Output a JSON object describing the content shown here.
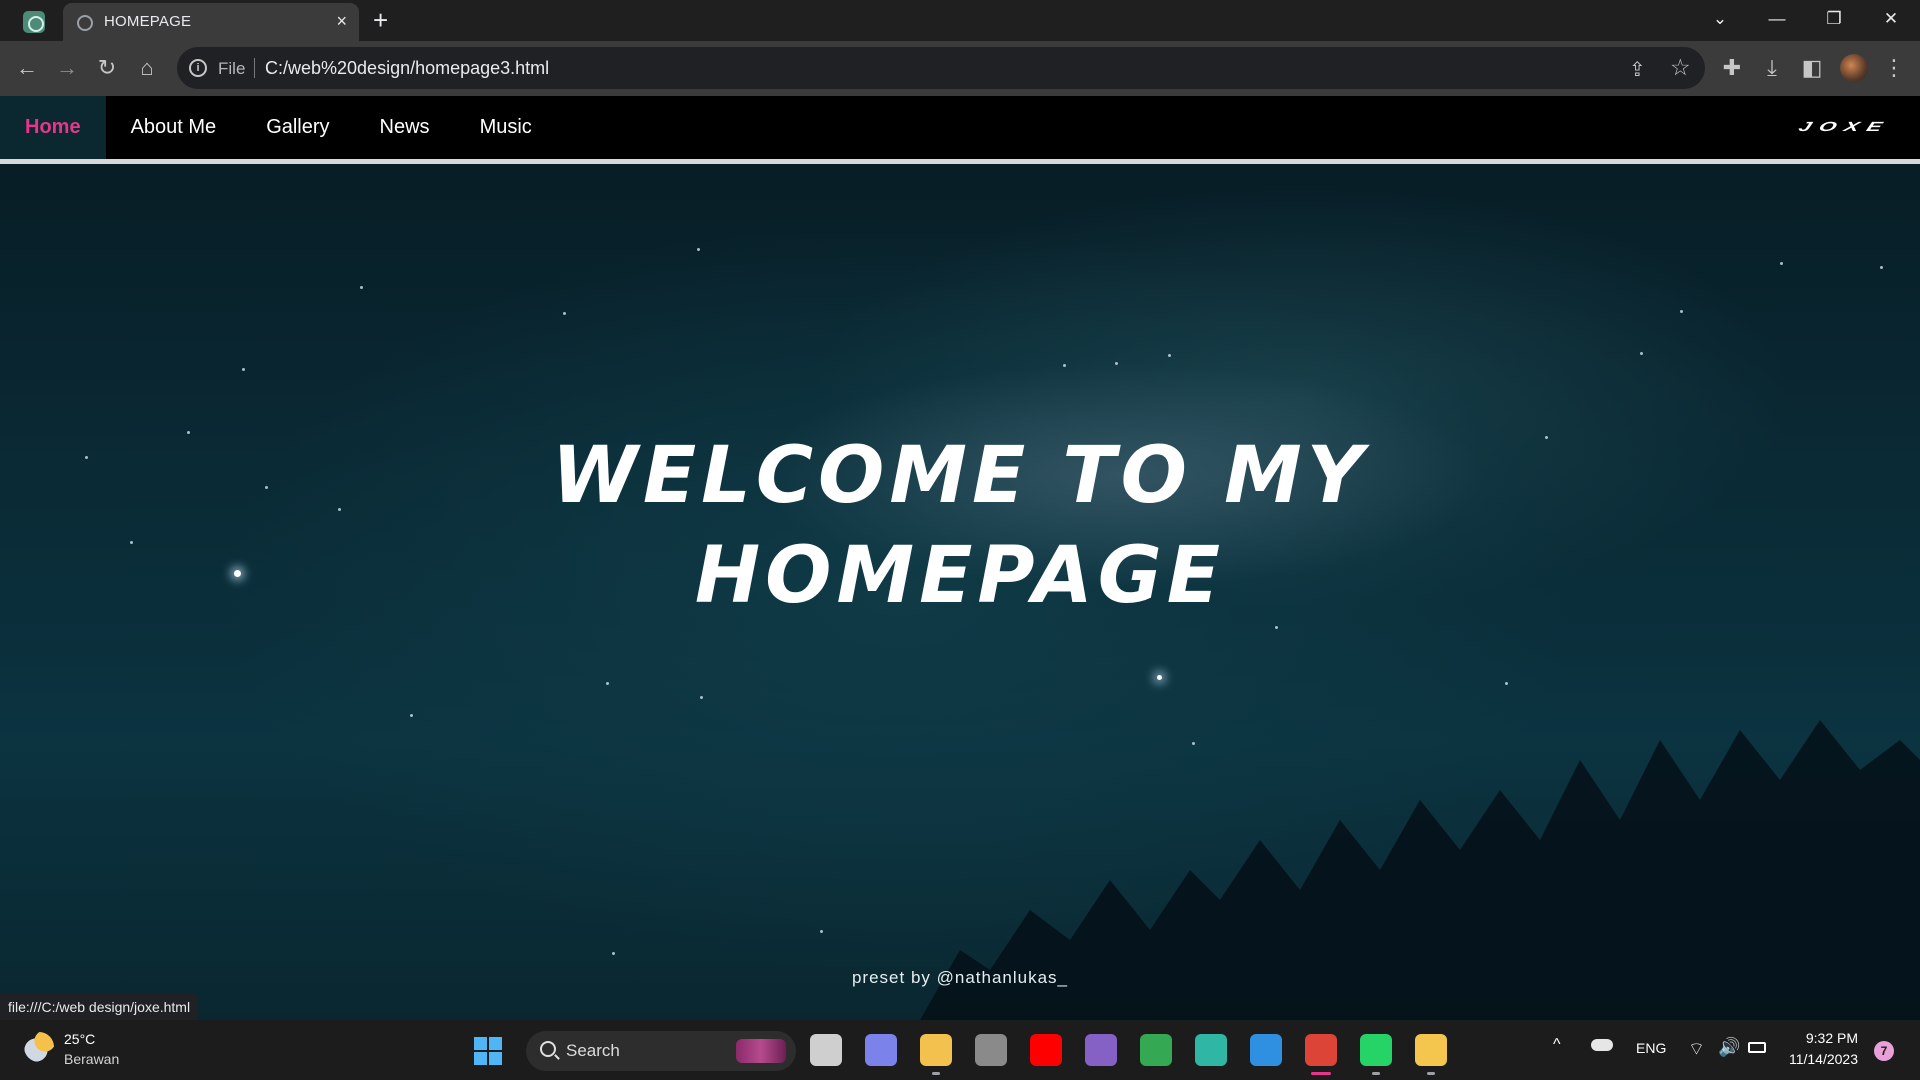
{
  "browser": {
    "tab": {
      "title": "HOMEPAGE",
      "close_glyph": "×"
    },
    "newtab_glyph": "+",
    "window_controls": {
      "tab_search": "⌄",
      "minimize": "—",
      "restore": "❐",
      "close": "✕"
    },
    "toolbar": {
      "back": "←",
      "forward": "→",
      "reload": "↻",
      "home": "⌂",
      "site_info_glyph": "i",
      "scheme_label": "File",
      "url": "C:/web%20design/homepage3.html",
      "share": "⇪",
      "bookmark": "☆",
      "extensions": "✚",
      "downloads": "⤓",
      "side_panel": "◧",
      "menu": "⋮"
    },
    "status_url": "file:///C:/web design/joxe.html"
  },
  "site": {
    "nav": [
      {
        "label": "Home",
        "active": true
      },
      {
        "label": "About Me",
        "active": false
      },
      {
        "label": "Gallery",
        "active": false
      },
      {
        "label": "News",
        "active": false
      },
      {
        "label": "Music",
        "active": false
      }
    ],
    "brand": "JOXE",
    "hero": {
      "line1": "WELCOME TO MY",
      "line2": "HOMEPAGE"
    },
    "credit": "preset by @nathanlukas_",
    "colors": {
      "accent": "#e8358b",
      "nav_bg": "#000000",
      "sky": "#0b3340"
    }
  },
  "taskbar": {
    "weather": {
      "temp": "25°C",
      "desc": "Berawan"
    },
    "search_label": "Search",
    "apps": [
      {
        "name": "task-view-icon",
        "color": "#cfcfcf",
        "running": false
      },
      {
        "name": "teams-icon",
        "color": "#7b83eb",
        "running": false
      },
      {
        "name": "file-explorer-icon",
        "color": "#f2c14e",
        "running": true
      },
      {
        "name": "shield-app-icon",
        "color": "#8a8a8a",
        "running": false
      },
      {
        "name": "youtube-icon",
        "color": "#ff0000",
        "running": false
      },
      {
        "name": "visual-studio-icon",
        "color": "#8661c5",
        "running": false
      },
      {
        "name": "chrome-icon",
        "color": "#34a853",
        "running": false
      },
      {
        "name": "edge-icon",
        "color": "#2fb6a5",
        "running": false
      },
      {
        "name": "vscode-icon",
        "color": "#2f8fe0",
        "running": false
      },
      {
        "name": "chrome-profile-icon",
        "color": "#db4437",
        "running": true,
        "active": true
      },
      {
        "name": "whatsapp-icon",
        "color": "#25d366",
        "running": true
      },
      {
        "name": "notes-app-icon",
        "color": "#f4c64d",
        "running": true
      }
    ],
    "tray": {
      "chevron": "^",
      "language": "ENG",
      "wifi": "⌔",
      "volume": "🔊",
      "time": "9:32 PM",
      "date": "11/14/2023",
      "notifications": "7"
    }
  }
}
